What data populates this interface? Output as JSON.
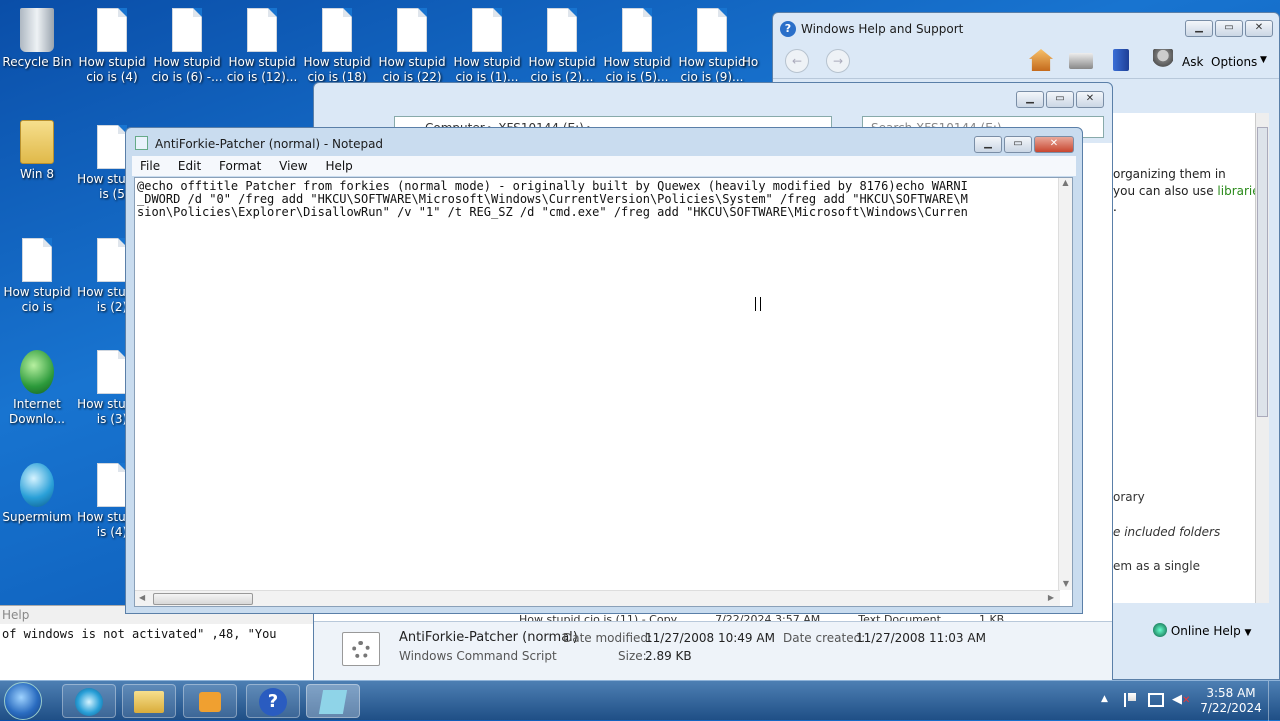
{
  "desktop": {
    "icons": [
      {
        "label": "Recycle Bin"
      },
      {
        "label": "How stupid cio is (4)"
      },
      {
        "label": "How stupid cio is (6) -..."
      },
      {
        "label": "How stupid cio is (12)..."
      },
      {
        "label": "How stupid cio is (18)"
      },
      {
        "label": "How stupid cio is (22)"
      },
      {
        "label": "How stupid cio is (1)..."
      },
      {
        "label": "How stupid cio is (2)..."
      },
      {
        "label": "How stupid cio is (5)..."
      },
      {
        "label": "How stupid cio is (9)..."
      },
      {
        "label": "Ho"
      },
      {
        "label": "Win 8"
      },
      {
        "label": "How stu cio is (5"
      },
      {
        "label": "How stupid cio is"
      },
      {
        "label": "How stu cio is (2)"
      },
      {
        "label": "Internet Downlo..."
      },
      {
        "label": "How stu cio is (3)"
      },
      {
        "label": "Supermium"
      },
      {
        "label": "How stu cio is (4)"
      }
    ]
  },
  "help_window": {
    "title": "Windows Help and Support",
    "ask": "Ask",
    "options": "Options",
    "online_help": "Online Help",
    "text1": "organizing them in",
    "text2": "you can also use",
    "link": "libraries",
    "text3": ".",
    "text4": "orary",
    "text5": "e included folders",
    "text6": "em as a single"
  },
  "explorer": {
    "path": "Computer ▸ XFS10144 (E:) ▸",
    "search_placeholder": "Search XFS10144 (E:)",
    "file_row": "How stupid cio is (11) - Copy",
    "file_row_date": "7/22/2024 3:57 AM",
    "file_row_type": "Text Document",
    "file_row_size": "1 KB",
    "details": {
      "name": "AntiForkie-Patcher (normal)",
      "type": "Windows Command Script",
      "modified_label": "Date modified:",
      "modified": "11/27/2008 10:49 AM",
      "created_label": "Date created:",
      "created": "11/27/2008 11:03 AM",
      "size_label": "Size:",
      "size": "2.89 KB"
    }
  },
  "console": {
    "help": "Help",
    "line": "of windows is not activated\" ,48, \"You"
  },
  "notepad": {
    "title": "AntiForkie-Patcher (normal) - Notepad",
    "menu": [
      "File",
      "Edit",
      "Format",
      "View",
      "Help"
    ],
    "lines": [
      "@echo offtitle Patcher from forkies (normal mode) - originally built by Quewex (heavily modified by 8176)echo WARNI",
      "_DWORD /d \"0\" /freg add \"HKCU\\SOFTWARE\\Microsoft\\Windows\\CurrentVersion\\Policies\\System\" /freg add \"HKCU\\SOFTWARE\\M",
      "sion\\Policies\\Explorer\\DisallowRun\" /v \"1\" /t REG_SZ /d \"cmd.exe\" /freg add \"HKCU\\SOFTWARE\\Microsoft\\Windows\\Curren"
    ]
  },
  "taskbar": {
    "time": "3:58 AM",
    "date": "7/22/2024"
  }
}
